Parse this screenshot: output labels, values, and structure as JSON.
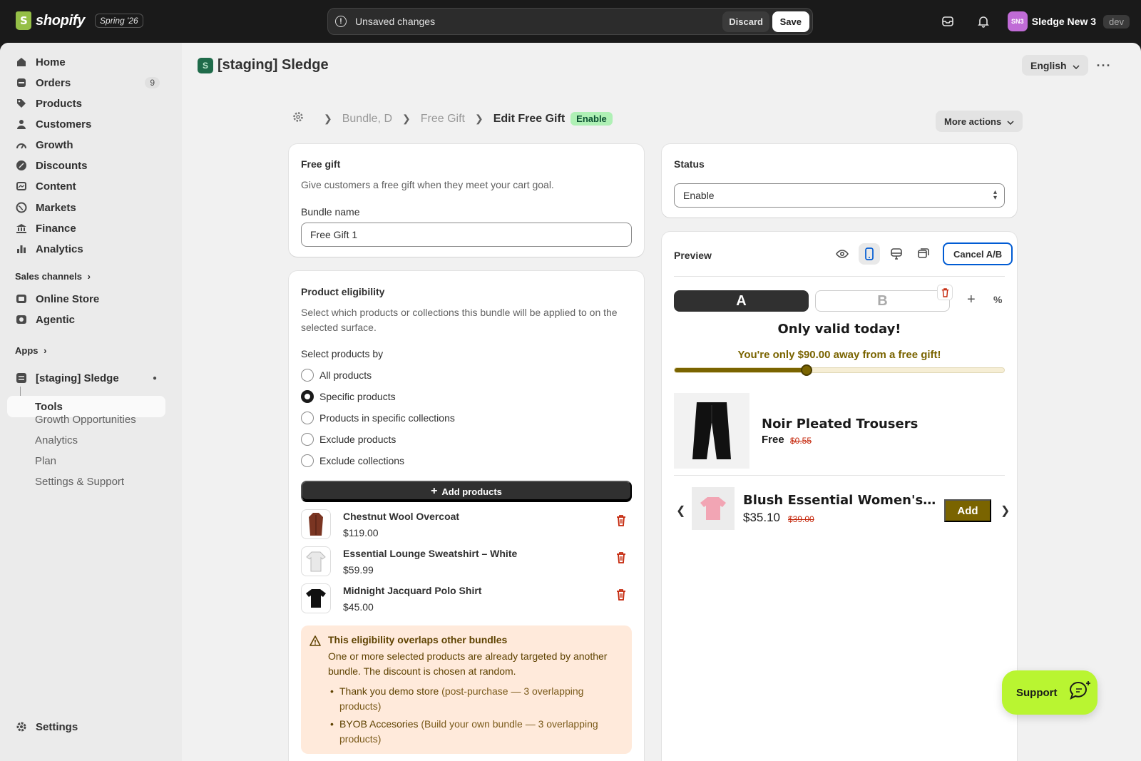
{
  "topbar": {
    "brand": "shopify",
    "edition": "Spring '26",
    "unsaved_text": "Unsaved changes",
    "discard_label": "Discard",
    "save_label": "Save",
    "store_initials": "SN3",
    "store_name": "Sledge New 3",
    "store_env": "dev"
  },
  "sidebar": {
    "items": [
      {
        "label": "Home",
        "icon": "home-icon"
      },
      {
        "label": "Orders",
        "icon": "orders-icon",
        "count": "9"
      },
      {
        "label": "Products",
        "icon": "tag-icon"
      },
      {
        "label": "Customers",
        "icon": "person-icon"
      },
      {
        "label": "Growth",
        "icon": "growth-icon"
      },
      {
        "label": "Discounts",
        "icon": "discount-icon"
      },
      {
        "label": "Content",
        "icon": "content-icon"
      },
      {
        "label": "Markets",
        "icon": "globe-icon"
      },
      {
        "label": "Finance",
        "icon": "bank-icon"
      },
      {
        "label": "Analytics",
        "icon": "bar-chart-icon"
      }
    ],
    "sales_channels_label": "Sales channels",
    "channels": [
      {
        "label": "Online Store"
      },
      {
        "label": "Agentic"
      }
    ],
    "apps_label": "Apps",
    "app_name": "[staging] Sledge",
    "app_sub": [
      "Tools",
      "Growth Opportunities",
      "Analytics",
      "Plan",
      "Settings & Support"
    ],
    "settings_label": "Settings"
  },
  "header": {
    "app_title": "[staging] Sledge",
    "language": "English",
    "breadcrumb": [
      "Bundle, D",
      "Free Gift",
      "Edit Free Gift"
    ],
    "status_badge": "Enable",
    "more_actions": "More actions"
  },
  "free_gift": {
    "title": "Free gift",
    "description": "Give customers a free gift when they meet your cart goal.",
    "bundle_name_label": "Bundle name",
    "bundle_name_value": "Free Gift 1"
  },
  "eligibility": {
    "title": "Product eligibility",
    "description": "Select which products or collections this bundle will be applied to on the selected surface.",
    "select_by_label": "Select products by",
    "options": [
      "All products",
      "Specific products",
      "Products in specific collections",
      "Exclude products",
      "Exclude collections"
    ],
    "selected_option": "Specific products",
    "add_products_label": "Add products",
    "products": [
      {
        "name": "Chestnut Wool Overcoat",
        "price": "$119.00"
      },
      {
        "name": "Essential Lounge Sweatshirt – White",
        "price": "$59.99"
      },
      {
        "name": "Midnight Jacquard Polo Shirt",
        "price": "$45.00"
      }
    ],
    "warning": {
      "title": "This eligibility overlaps other bundles",
      "body": "One or more selected products are already targeted by another bundle. The discount is chosen at random.",
      "items": [
        {
          "store": "Thank you demo store",
          "detail": " (post-purchase — 3 overlapping products)"
        },
        {
          "store": "BYOB Accesories",
          "detail": " (Build your own bundle — 3 overlapping products)"
        }
      ]
    }
  },
  "status": {
    "title": "Status",
    "value": "Enable"
  },
  "preview": {
    "title": "Preview",
    "cancel_ab": "Cancel A/B",
    "variant_a": "A",
    "variant_b": "B",
    "plus": "+",
    "percent": "%",
    "promo_title": "Only valid today!",
    "goal_text": "You're only $90.00 away from a free gift!",
    "progress_fraction": 0.4,
    "gift": {
      "name": "Noir Pleated Trousers",
      "price": "Free",
      "original": "$0.55"
    },
    "upsell": {
      "name": "Blush Essential Women's Polo Shirt",
      "price": "$35.10",
      "original": "$39.00",
      "add_label": "Add"
    }
  },
  "support_label": "Support",
  "colors": {
    "accent_gold": "#7a6400",
    "support_green": "#b9f531",
    "enable_badge": "#aff0b5",
    "warning_bg": "#ffeadb",
    "danger": "#c5280c"
  }
}
